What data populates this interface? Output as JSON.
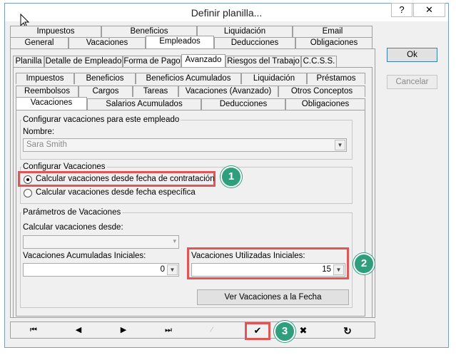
{
  "window": {
    "title": "Definir planilla...",
    "help_glyph": "?",
    "close_glyph": "✕"
  },
  "tabs_row1": [
    "Impuestos",
    "Beneficios",
    "Liquidación",
    "Email"
  ],
  "tabs_row2": [
    "General",
    "Vacaciones",
    "Empleados",
    "Deducciones",
    "Obligaciones"
  ],
  "tabs_row3": [
    "Planilla",
    "Detalle de Empleado",
    "Forma de Pago",
    "Avanzado",
    "Riesgos del Trabajo",
    "C.C.S.S."
  ],
  "tabs_row4": [
    "Impuestos",
    "Beneficios",
    "Beneficios Acumulados",
    "Liquidación",
    "Préstamos"
  ],
  "tabs_row5": [
    "Reembolsos",
    "Cargos",
    "Tareas",
    "Vacaciones (Avanzado)",
    "Otros Conceptos"
  ],
  "tabs_row6": [
    "Vacaciones",
    "Salarios Acumulados",
    "Deducciones",
    "Obligaciones"
  ],
  "side": {
    "ok": "Ok",
    "cancel": "Cancelar"
  },
  "employee": {
    "legend": "Configurar vacaciones para este empleado",
    "name_label": "Nombre:",
    "name_value": "Sara Smith"
  },
  "config": {
    "legend": "Configurar Vacaciones",
    "option1": "Calcular vacaciones desde fecha de contratación",
    "option2": "Calcular vacaciones desde fecha específica"
  },
  "params": {
    "legend": "Parámetros de Vacaciones",
    "calc_from_label": "Calcular vacaciones desde:",
    "accum_label": "Vacaciones Acumuladas Iniciales:",
    "accum_value": "0",
    "used_label": "Vacaciones Utilizadas Iniciales:",
    "used_value": "15",
    "view_button": "Ver Vacaciones a la Fecha"
  },
  "nav": {
    "first": "⏮",
    "prev": "◀",
    "next": "▶",
    "last": "⏭",
    "edit": "⁄",
    "save": "✔",
    "cancel": "✖",
    "refresh": "↻"
  },
  "callouts": [
    "1",
    "2",
    "3"
  ],
  "colors": {
    "callout_border": "#e05555",
    "badge": "#2f9e7a"
  }
}
